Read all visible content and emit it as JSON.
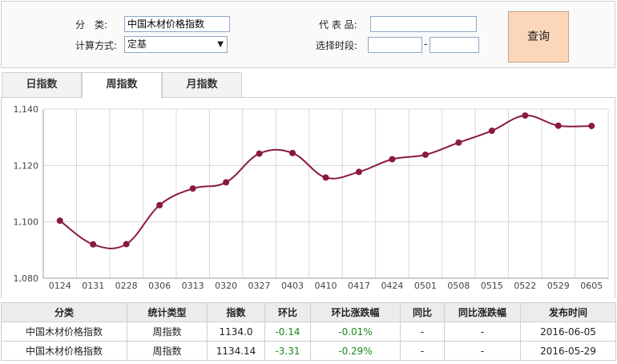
{
  "query": {
    "category_label": "分　类:",
    "category_value": "中国木材价格指数",
    "method_label": "计算方式:",
    "method_value": "定基",
    "product_label": "代 表 品:",
    "product_value": "",
    "period_label": "选择时段:",
    "period_start": "",
    "period_separator": "-",
    "period_end": "",
    "submit_label": "查询"
  },
  "tabs": [
    {
      "label": "日指数",
      "active": false
    },
    {
      "label": "周指数",
      "active": true
    },
    {
      "label": "月指数",
      "active": false
    }
  ],
  "chart_data": {
    "type": "line",
    "categories": [
      "0124",
      "0131",
      "0228",
      "0306",
      "0313",
      "0320",
      "0327",
      "0403",
      "0410",
      "0417",
      "0424",
      "0501",
      "0508",
      "0515",
      "0522",
      "0529",
      "0605"
    ],
    "values": [
      1100.4,
      1092.0,
      1092.1,
      1105.9,
      1111.8,
      1114.0,
      1124.2,
      1124.4,
      1115.7,
      1117.7,
      1122.2,
      1123.8,
      1128.1,
      1132.3,
      1137.7,
      1134.1,
      1134.0
    ],
    "ylim": [
      1080,
      1140
    ],
    "yticks": [
      "1,080",
      "1,100",
      "1,120",
      "1,140"
    ],
    "line_color": "#8b1a3a",
    "grid": true
  },
  "table": {
    "headers": [
      "分类",
      "统计类型",
      "指数",
      "环比",
      "环比涨跌幅",
      "同比",
      "同比涨跌幅",
      "发布时间"
    ],
    "rows": [
      [
        "中国木材价格指数",
        "周指数",
        "1134.0",
        "-0.14",
        "-0.01%",
        "-",
        "-",
        "2016-06-05"
      ],
      [
        "中国木材价格指数",
        "周指数",
        "1134.14",
        "-3.31",
        "-0.29%",
        "-",
        "-",
        "2016-05-29"
      ]
    ],
    "change_color": "#1a8a1a"
  }
}
